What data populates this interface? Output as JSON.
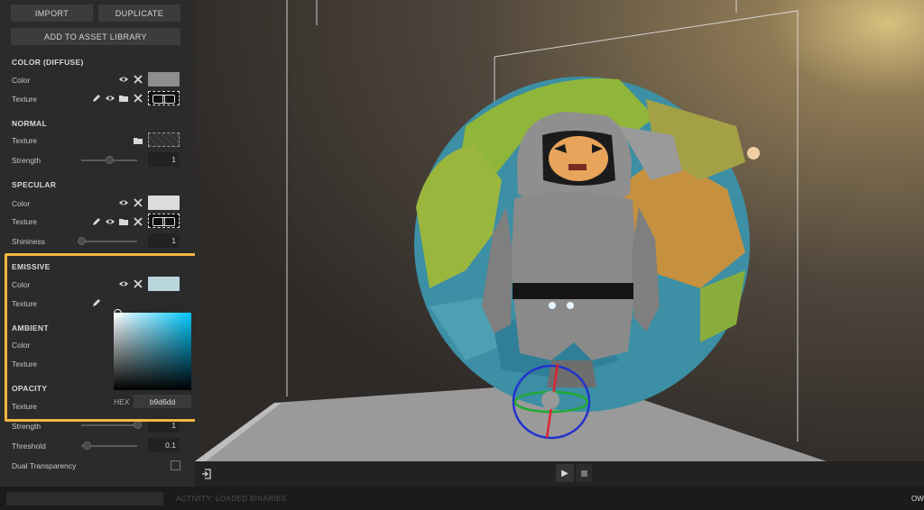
{
  "toolbar": {
    "import_label": "IMPORT",
    "duplicate_label": "DUPLICATE",
    "add_library_label": "ADD TO ASSET LIBRARY"
  },
  "diffuse": {
    "title": "COLOR (DIFFUSE)",
    "color_label": "Color",
    "texture_label": "Texture",
    "color": "#8e8e8e"
  },
  "normal": {
    "title": "NORMAL",
    "texture_label": "Texture",
    "strength_label": "Strength",
    "strength_value": "1",
    "strength_level": 0.5
  },
  "specular": {
    "title": "SPECULAR",
    "color_label": "Color",
    "texture_label": "Texture",
    "shininess_label": "Shininess",
    "shininess_value": "1",
    "color": "#dcdcdc",
    "shininess_level": 0.0
  },
  "emissive": {
    "title": "EMISSIVE",
    "color_label": "Color",
    "texture_label": "Texture",
    "color": "#b9d6dd"
  },
  "ambient": {
    "title": "AMBIENT",
    "color_label": "Color",
    "texture_label": "Texture"
  },
  "opacity": {
    "title": "OPACITY",
    "texture_label": "Texture",
    "strength_label": "Strength",
    "strength_value": "1",
    "strength_level": 1.0,
    "threshold_label": "Threshold",
    "threshold_value": "0.1",
    "threshold_level": 0.1,
    "dual_label": "Dual Transparency",
    "dual_checked": false
  },
  "color_picker": {
    "hex_label": "HEX",
    "hex_value": "b9d6dd",
    "hue_hex": "#48c8ff"
  },
  "status": {
    "text": "ACTIVITY: LOADED BINARIES",
    "right_text": "OW"
  },
  "colors": {
    "highlight": "#f5b544",
    "panel_bg": "#2b2b2b"
  }
}
